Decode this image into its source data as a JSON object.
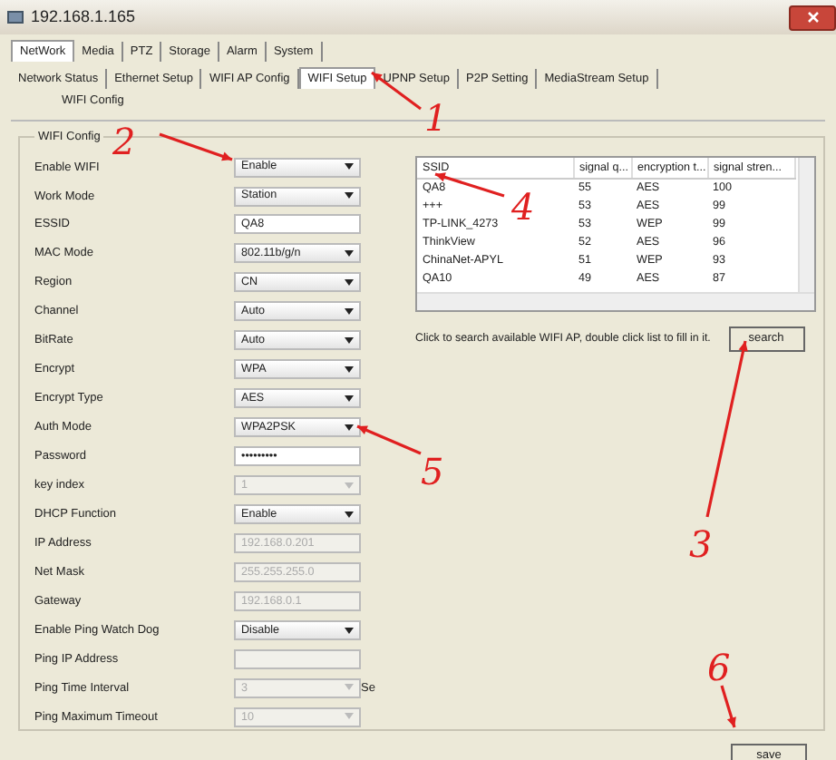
{
  "window": {
    "title": "192.168.1.165"
  },
  "tabs": [
    {
      "label": "NetWork",
      "selected": true
    },
    {
      "label": "Media",
      "selected": false
    },
    {
      "label": "PTZ",
      "selected": false
    },
    {
      "label": "Storage",
      "selected": false
    },
    {
      "label": "Alarm",
      "selected": false
    },
    {
      "label": "System",
      "selected": false
    }
  ],
  "subtabs": [
    {
      "label": "Network Status",
      "selected": false
    },
    {
      "label": "Ethernet Setup",
      "selected": false
    },
    {
      "label": "WIFI AP Config",
      "selected": false
    },
    {
      "label": "WIFI Setup",
      "selected": true
    },
    {
      "label": "UPNP Setup",
      "selected": false
    },
    {
      "label": "P2P Setting",
      "selected": false
    },
    {
      "label": "MediaStream Setup",
      "selected": false
    }
  ],
  "section_title": "WIFI Config",
  "group_title": "WIFI Config",
  "fields": [
    {
      "label": "Enable WIFI",
      "kind": "select",
      "value": "Enable",
      "disabled": false
    },
    {
      "label": "Work Mode",
      "kind": "select",
      "value": "Station",
      "disabled": false
    },
    {
      "label": "ESSID",
      "kind": "text",
      "value": "QA8",
      "disabled": false
    },
    {
      "label": "MAC Mode",
      "kind": "select",
      "value": "802.11b/g/n",
      "disabled": false
    },
    {
      "label": "Region",
      "kind": "select",
      "value": "CN",
      "disabled": false
    },
    {
      "label": "Channel",
      "kind": "select",
      "value": "Auto",
      "disabled": false
    },
    {
      "label": "BitRate",
      "kind": "select",
      "value": "Auto",
      "disabled": false
    },
    {
      "label": "Encrypt",
      "kind": "select",
      "value": "WPA",
      "disabled": false
    },
    {
      "label": "Encrypt Type",
      "kind": "select",
      "value": "AES",
      "disabled": false
    },
    {
      "label": "Auth Mode",
      "kind": "select",
      "value": "WPA2PSK",
      "disabled": false
    },
    {
      "label": "Password",
      "kind": "text",
      "value": "•••••••••",
      "disabled": false
    },
    {
      "label": "key index",
      "kind": "select",
      "value": "1",
      "disabled": true
    },
    {
      "label": "DHCP Function",
      "kind": "select",
      "value": "Enable",
      "disabled": false
    },
    {
      "label": "IP Address",
      "kind": "text",
      "value": "192.168.0.201",
      "disabled": true
    },
    {
      "label": "Net Mask",
      "kind": "text",
      "value": "255.255.255.0",
      "disabled": true
    },
    {
      "label": "Gateway",
      "kind": "text",
      "value": "192.168.0.1",
      "disabled": true
    },
    {
      "label": "Enable Ping Watch Dog",
      "kind": "select",
      "value": "Disable",
      "disabled": false
    },
    {
      "label": "Ping IP Address",
      "kind": "text",
      "disabled": true
    },
    {
      "label": "Ping Time Interval",
      "kind": "select",
      "value": "3",
      "disabled": true,
      "suffix": "Se"
    },
    {
      "label": "Ping Maximum Timeout",
      "kind": "select",
      "value": "10",
      "disabled": true
    }
  ],
  "table": {
    "columns": [
      "SSID",
      "signal q...",
      "encryption t...",
      "signal stren..."
    ],
    "rows": [
      [
        "QA8",
        "55",
        "AES",
        "100"
      ],
      [
        "+++",
        "53",
        "AES",
        "99"
      ],
      [
        "TP-LINK_4273",
        "53",
        "WEP",
        "99"
      ],
      [
        "ThinkView",
        "52",
        "AES",
        "96"
      ],
      [
        "ChinaNet-APYL",
        "51",
        "WEP",
        "93"
      ],
      [
        "QA10",
        "49",
        "AES",
        "87"
      ]
    ]
  },
  "hint": "Click to search available WIFI AP, double click list to fill in it.",
  "search_button": "search",
  "save_button": "save",
  "annotations": [
    {
      "label": "1"
    },
    {
      "label": "2"
    },
    {
      "label": "3"
    },
    {
      "label": "4"
    },
    {
      "label": "5"
    },
    {
      "label": "6"
    }
  ]
}
